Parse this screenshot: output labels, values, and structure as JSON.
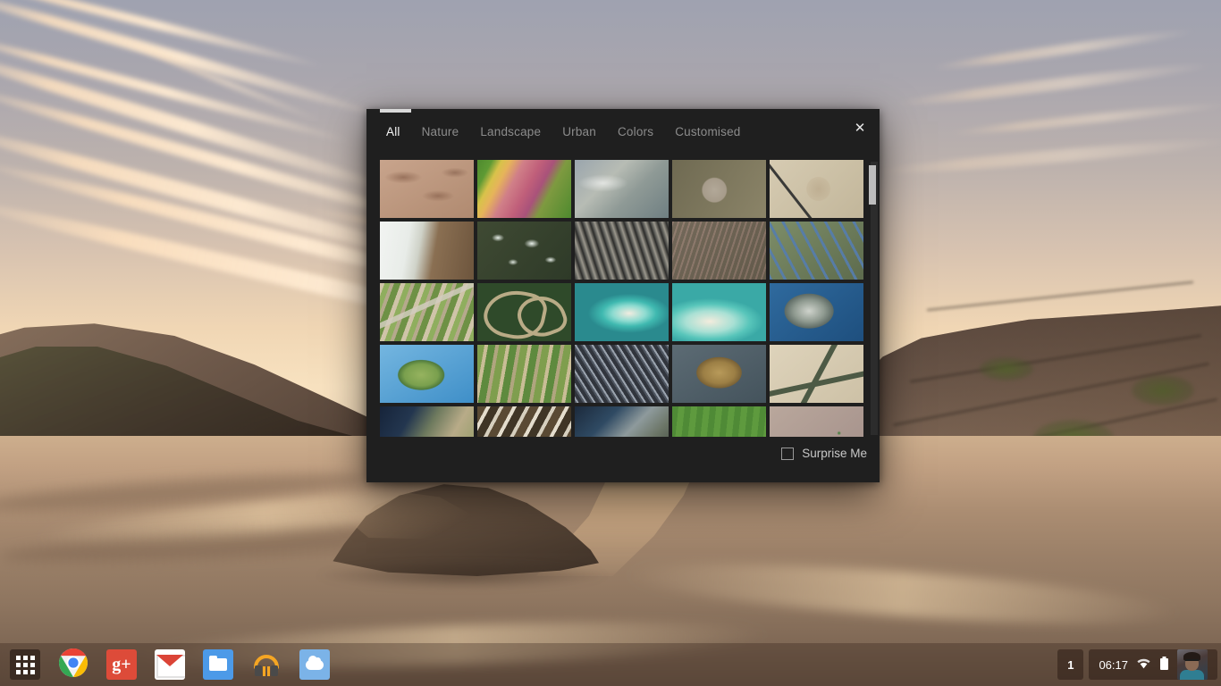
{
  "desktop": {
    "wallpaper_description": "Sunset beach with rocky cliffs, wet sand and reflected orange sky"
  },
  "shelf": {
    "apps": [
      {
        "name": "app-launcher",
        "label": "Launcher",
        "icon": "grid-icon",
        "running": false
      },
      {
        "name": "chrome",
        "label": "Google Chrome",
        "icon": "chrome-icon",
        "running": false
      },
      {
        "name": "google-plus",
        "label": "Google+",
        "icon": "google-plus-icon",
        "running": false
      },
      {
        "name": "gmail",
        "label": "Gmail",
        "icon": "gmail-icon",
        "running": false
      },
      {
        "name": "files",
        "label": "Files",
        "icon": "folder-icon",
        "running": false
      },
      {
        "name": "play-music",
        "label": "Google Play Music",
        "icon": "headphones-icon",
        "running": false
      },
      {
        "name": "wallpaper-picker",
        "label": "Wallpaper Picker",
        "icon": "cloud-icon",
        "running": true
      }
    ],
    "status": {
      "notification_count": "1",
      "time": "06:17",
      "wifi_icon": "wifi-icon",
      "battery_icon": "battery-icon",
      "avatar_label": "User avatar"
    }
  },
  "picker": {
    "progress_visible": true,
    "close_label": "✕",
    "tabs": [
      {
        "label": "All",
        "active": true
      },
      {
        "label": "Nature",
        "active": false
      },
      {
        "label": "Landscape",
        "active": false
      },
      {
        "label": "Urban",
        "active": false
      },
      {
        "label": "Colors",
        "active": false
      },
      {
        "label": "Customised",
        "active": false
      }
    ],
    "surprise": {
      "label": "Surprise Me",
      "checked": false
    },
    "thumbnails": [
      {
        "name": "desert-dunes",
        "art": "t-desert"
      },
      {
        "name": "tulip-fields",
        "art": "t-fields-pink"
      },
      {
        "name": "ice-floe",
        "art": "t-icefloe"
      },
      {
        "name": "crater-plain",
        "art": "t-crater"
      },
      {
        "name": "desert-circles",
        "art": "t-circles"
      },
      {
        "name": "glacier-edge",
        "art": "t-glacier"
      },
      {
        "name": "snowy-mountains",
        "art": "t-snowmtn"
      },
      {
        "name": "eroded-ridges",
        "art": "t-ridges"
      },
      {
        "name": "canyon-ridges",
        "art": "t-canyon"
      },
      {
        "name": "braided-rivers",
        "art": "t-rivers"
      },
      {
        "name": "road-through-fields",
        "art": "t-roadfields"
      },
      {
        "name": "meandering-river",
        "art": "t-meander"
      },
      {
        "name": "turquoise-lagoon",
        "art": "t-lagoon"
      },
      {
        "name": "sand-bars",
        "art": "t-sandbar"
      },
      {
        "name": "rocky-island",
        "art": "t-rockisle"
      },
      {
        "name": "green-island",
        "art": "t-island"
      },
      {
        "name": "farm-grid",
        "art": "t-farmgrid"
      },
      {
        "name": "frost-patterns",
        "art": "t-frost"
      },
      {
        "name": "reef-rock",
        "art": "t-reef"
      },
      {
        "name": "highway-interchange",
        "art": "t-interchange"
      },
      {
        "name": "coastal-village",
        "art": "t-coast"
      },
      {
        "name": "terraced-fields",
        "art": "t-terraces"
      },
      {
        "name": "river-delta",
        "art": "t-river2"
      },
      {
        "name": "green-farmland",
        "art": "t-green"
      },
      {
        "name": "orchard-rows",
        "art": "t-orchard"
      }
    ]
  }
}
